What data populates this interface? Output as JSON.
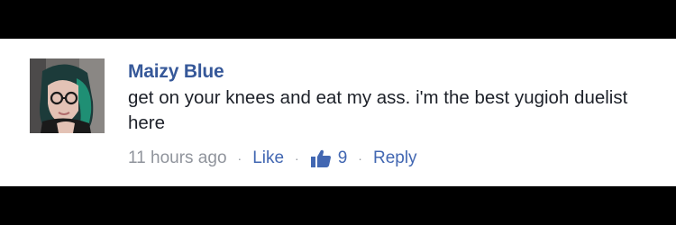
{
  "comment": {
    "author": "Maizy Blue",
    "text": "get on your knees and eat my ass. i'm the best yugioh duelist here",
    "timestamp": "11 hours ago",
    "separator": "·",
    "like_label": "Like",
    "like_count": "9",
    "reply_label": "Reply"
  },
  "icons": {
    "avatar": "avatar",
    "reaction": "thumbs-up-icon"
  },
  "colors": {
    "author_name": "#365899",
    "link": "#4267b2",
    "meta_gray": "#90949c",
    "body_text": "#1d2129",
    "frame_background": "#000000",
    "card_background": "#ffffff"
  }
}
